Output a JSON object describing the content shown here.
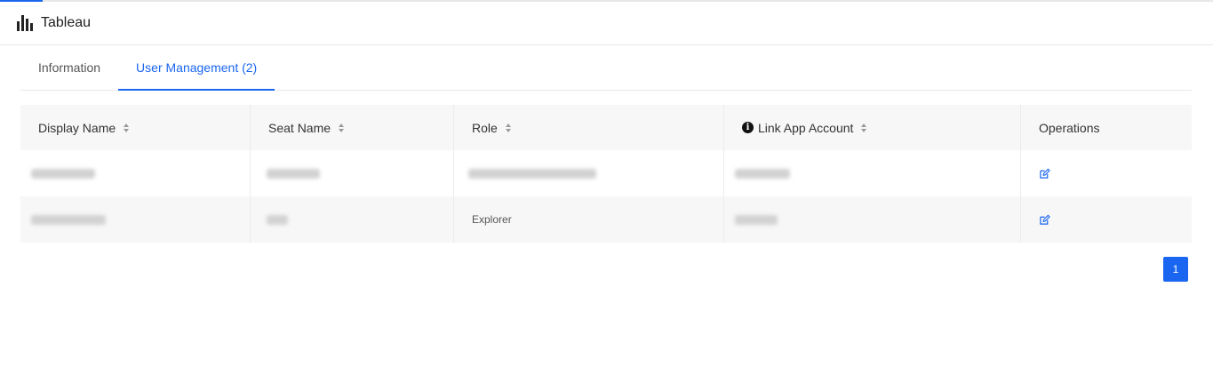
{
  "progress": {
    "value_percent": 3.5,
    "color": "#1a66f0"
  },
  "header": {
    "app_title": "Tableau",
    "logo_icon": "bar-chart-icon"
  },
  "tabs": [
    {
      "label": "Information",
      "active": false
    },
    {
      "label": "User Management (2)",
      "active": true
    }
  ],
  "table": {
    "columns": [
      {
        "label": "Display Name",
        "sortable": true
      },
      {
        "label": "Seat Name",
        "sortable": true
      },
      {
        "label": "Role",
        "sortable": true
      },
      {
        "label": "Link App Account",
        "sortable": true,
        "icon": "info-icon",
        "icon_glyph": "i"
      },
      {
        "label": "Operations",
        "sortable": false
      }
    ],
    "rows": [
      {
        "display_name": "",
        "seat_name": "",
        "role": "",
        "link_app_account": "",
        "operation_icon": "edit-icon"
      },
      {
        "display_name": "",
        "seat_name": "",
        "role": "Explorer",
        "link_app_account": "",
        "operation_icon": "edit-icon"
      }
    ]
  },
  "pagination": {
    "current_page": "1"
  },
  "colors": {
    "accent": "#1a66f0",
    "header_bg": "#f7f7f7",
    "alt_row_bg": "#f7f7f7"
  }
}
